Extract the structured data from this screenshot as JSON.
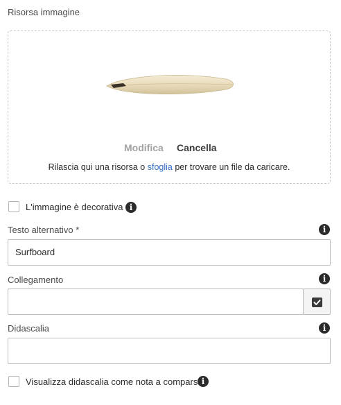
{
  "asset": {
    "section_label": "Risorsa immagine",
    "image_name": "surfboard-image",
    "modify_label": "Modifica",
    "cancel_label": "Cancella",
    "drop_text_before": "Rilascia qui una risorsa o ",
    "drop_link": "sfoglia",
    "drop_text_after": " per trovare un file da caricare."
  },
  "decorative": {
    "label": "L'immagine è decorativa",
    "checked": false
  },
  "alt_text": {
    "label": "Testo alternativo *",
    "value": "Surfboard"
  },
  "link": {
    "label": "Collegamento",
    "value": ""
  },
  "caption": {
    "label": "Didascalia",
    "value": ""
  },
  "caption_popup": {
    "label": "Visualizza didascalia come nota a comparsa",
    "checked": false
  },
  "icons": {
    "info": "info-icon",
    "picker": "check-square-icon"
  }
}
